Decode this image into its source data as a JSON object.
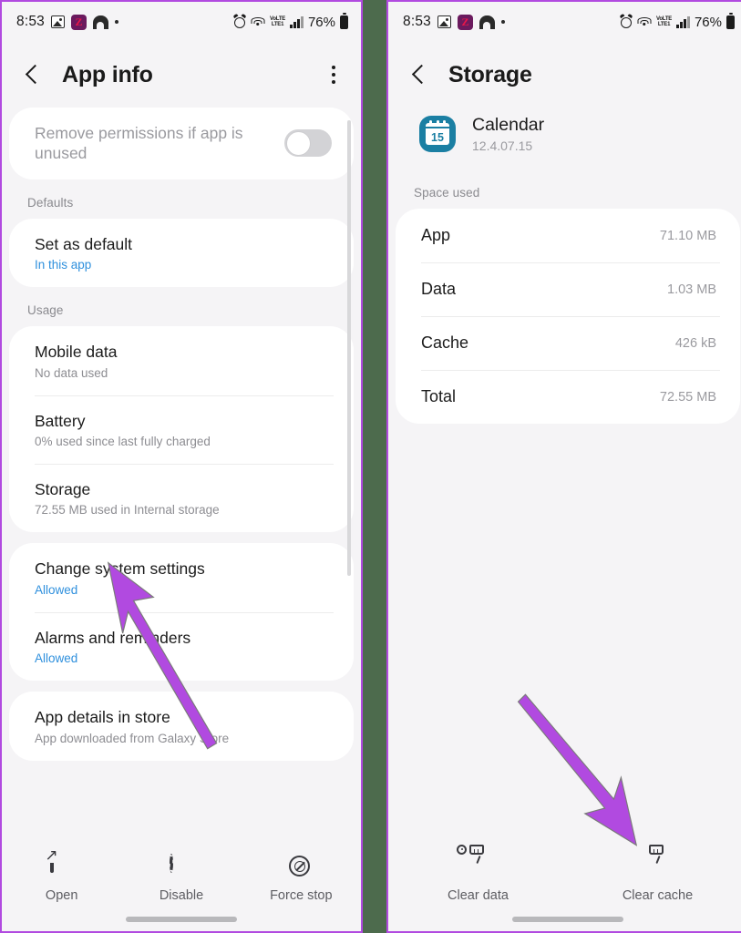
{
  "status_bar": {
    "time": "8:53",
    "battery_percent": "76%",
    "network_label": "VoLTE LTE1",
    "icons": [
      "photo-icon",
      "z-app-icon",
      "home-icon",
      "dot-icon",
      "alarm-icon",
      "wifi-icon",
      "volte-icon",
      "signal-bars-icon",
      "battery-icon"
    ]
  },
  "left_panel": {
    "title": "App info",
    "back_icon": "back-chevron-icon",
    "overflow_icon": "kebab-menu-icon",
    "permissions_row": {
      "title": "Remove permissions if app is unused",
      "toggle_state": "off"
    },
    "sections": [
      {
        "label": "Defaults",
        "rows": [
          {
            "title": "Set as default",
            "sub": "In this app",
            "sub_style": "link"
          }
        ]
      },
      {
        "label": "Usage",
        "rows": [
          {
            "title": "Mobile data",
            "sub": "No data used",
            "sub_style": "muted"
          },
          {
            "title": "Battery",
            "sub": "0% used since last fully charged",
            "sub_style": "muted"
          },
          {
            "title": "Storage",
            "sub": "72.55 MB used in Internal storage",
            "sub_style": "muted"
          }
        ]
      },
      {
        "label": "",
        "rows": [
          {
            "title": "Change system settings",
            "sub": "Allowed",
            "sub_style": "link"
          },
          {
            "title": "Alarms and reminders",
            "sub": "Allowed",
            "sub_style": "link"
          }
        ]
      },
      {
        "label": "",
        "rows": [
          {
            "title": "App details in store",
            "sub": "App downloaded from Galaxy Store",
            "sub_style": "muted"
          }
        ]
      }
    ],
    "bottom_actions": [
      {
        "label": "Open",
        "icon": "open-external-icon"
      },
      {
        "label": "Disable",
        "icon": "disable-circle-icon"
      },
      {
        "label": "Force stop",
        "icon": "force-stop-icon"
      }
    ]
  },
  "right_panel": {
    "title": "Storage",
    "back_icon": "back-chevron-icon",
    "app": {
      "name": "Calendar",
      "version": "12.4.07.15",
      "icon": "calendar-app-icon",
      "icon_day": "15"
    },
    "section_label": "Space used",
    "storage_rows": [
      {
        "key": "App",
        "value": "71.10 MB"
      },
      {
        "key": "Data",
        "value": "1.03 MB"
      },
      {
        "key": "Cache",
        "value": "426 kB"
      },
      {
        "key": "Total",
        "value": "72.55 MB"
      }
    ],
    "bottom_actions": [
      {
        "label": "Clear data",
        "icon": "clear-data-icon"
      },
      {
        "label": "Clear cache",
        "icon": "clear-cache-icon"
      }
    ]
  },
  "annotations": {
    "accent_color": "#b14ae0",
    "arrow_color": "#b14ae0",
    "arrows": [
      {
        "name": "arrow-to-storage",
        "points_to": "Storage"
      },
      {
        "name": "arrow-to-clear-cache",
        "points_to": "Clear cache"
      }
    ]
  },
  "theme": {
    "page_background": "#4d6b4d",
    "panel_background": "#f5f4f6",
    "card_background": "#ffffff",
    "link_color": "#2f90dd",
    "calendar_icon_color": "#1b7fa3"
  }
}
